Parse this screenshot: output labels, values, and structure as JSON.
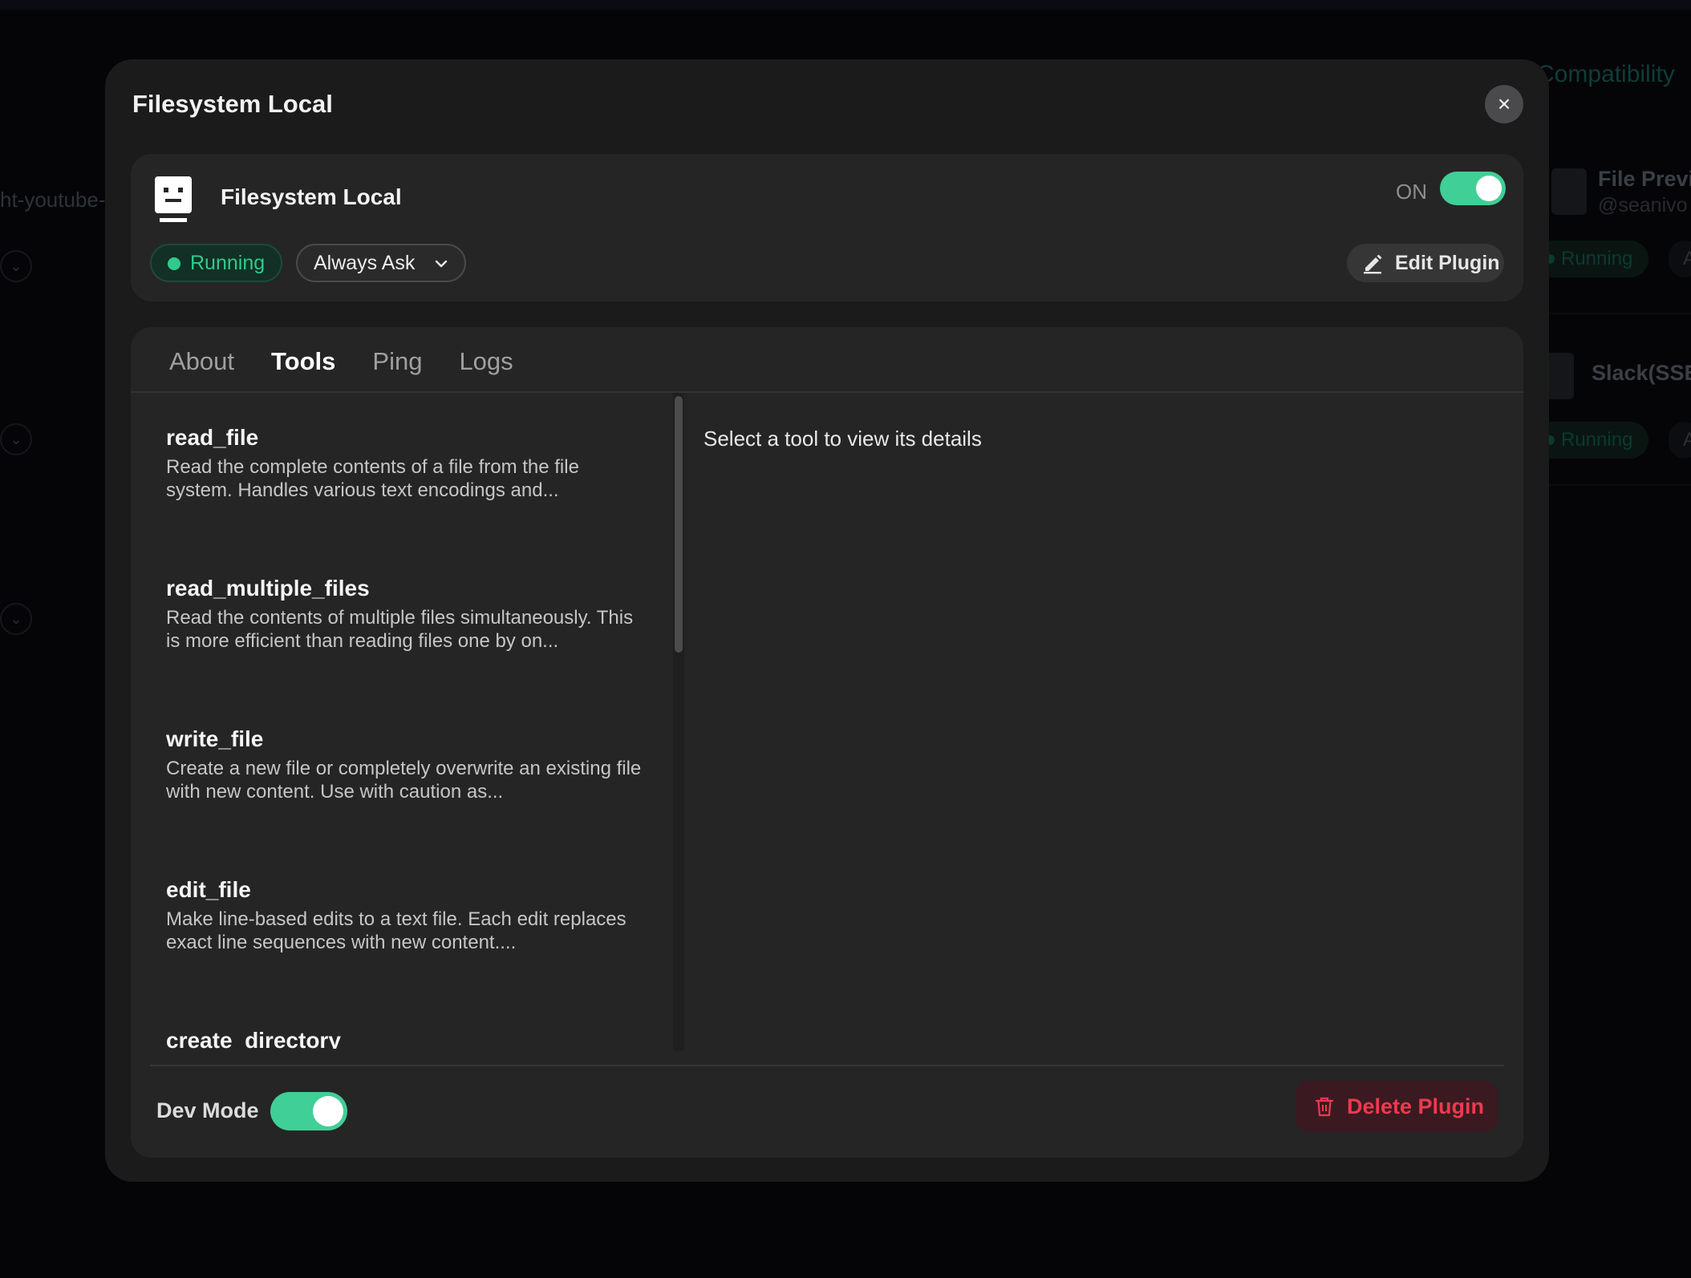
{
  "background": {
    "compatibility_text": "Compatibility",
    "left_cut_text": "ht-youtube-",
    "card1_title": "File Previ",
    "card1_sub": "@seanivo",
    "card2_title": "Slack(SSE",
    "running_label": "Running",
    "partial_label": "A"
  },
  "modal": {
    "title": "Filesystem Local",
    "close_icon": "×"
  },
  "header": {
    "plugin_name": "Filesystem Local",
    "on_label": "ON",
    "status_label": "Running",
    "permission_select": "Always Ask",
    "edit_button": "Edit Plugin"
  },
  "tabs": [
    {
      "label": "About",
      "active": false
    },
    {
      "label": "Tools",
      "active": true
    },
    {
      "label": "Ping",
      "active": false
    },
    {
      "label": "Logs",
      "active": false
    }
  ],
  "tools": [
    {
      "name": "read_file",
      "description": "Read the complete contents of a file from the file system. Handles various text encodings and..."
    },
    {
      "name": "read_multiple_files",
      "description": "Read the contents of multiple files simultaneously. This is more efficient than reading files one by on..."
    },
    {
      "name": "write_file",
      "description": "Create a new file or completely overwrite an existing file with new content. Use with caution as..."
    },
    {
      "name": "edit_file",
      "description": "Make line-based edits to a text file. Each edit replaces exact line sequences with new content...."
    },
    {
      "name": "create_directory",
      "description": ""
    }
  ],
  "detail": {
    "empty_message": "Select a tool to view its details"
  },
  "footer": {
    "dev_mode_label": "Dev Mode",
    "delete_button": "Delete Plugin"
  },
  "colors": {
    "accent_green": "#3fcf97",
    "danger_red": "#f0394f",
    "modal_bg": "#1b1b1b",
    "card_bg": "#252525"
  },
  "icons": {
    "close": "close-icon",
    "plugin": "robot-icon",
    "chevron": "chevron-down-icon",
    "edit": "pencil-icon",
    "delete": "trash-icon"
  }
}
